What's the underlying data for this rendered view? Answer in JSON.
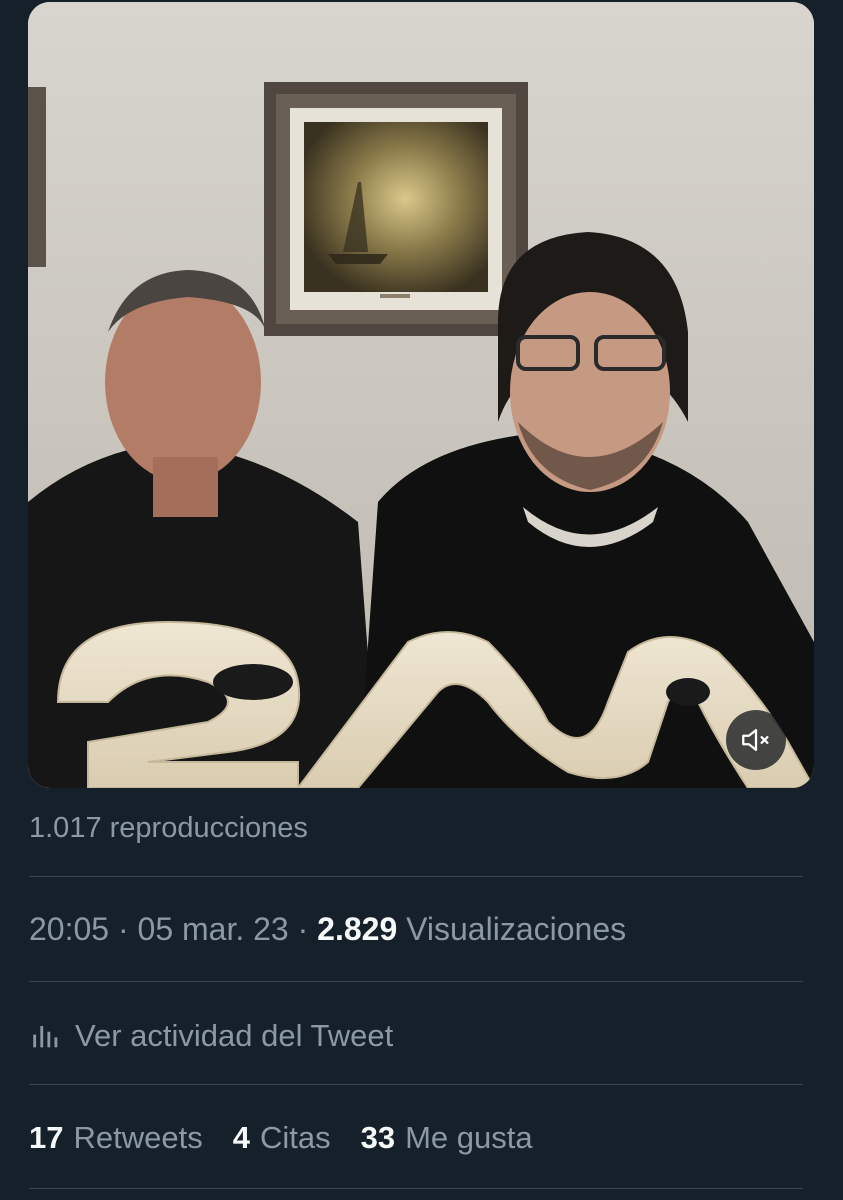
{
  "video": {
    "mute_icon": "speaker-muted-icon"
  },
  "stats": {
    "plays": "1.017 reproducciones",
    "time": "20:05",
    "separator": "·",
    "date": "05 mar. 23",
    "views_count": "2.829",
    "views_label": "Visualizaciones"
  },
  "activity": {
    "icon": "bar-chart-icon",
    "label": "Ver actividad del Tweet"
  },
  "counts": [
    {
      "value": "17",
      "label": "Retweets"
    },
    {
      "value": "4",
      "label": "Citas"
    },
    {
      "value": "33",
      "label": "Me gusta"
    }
  ],
  "colors": {
    "background": "#15202b",
    "divider": "#38444d",
    "secondary_text": "#8b98a5",
    "primary_text": "#f7f9f9"
  }
}
